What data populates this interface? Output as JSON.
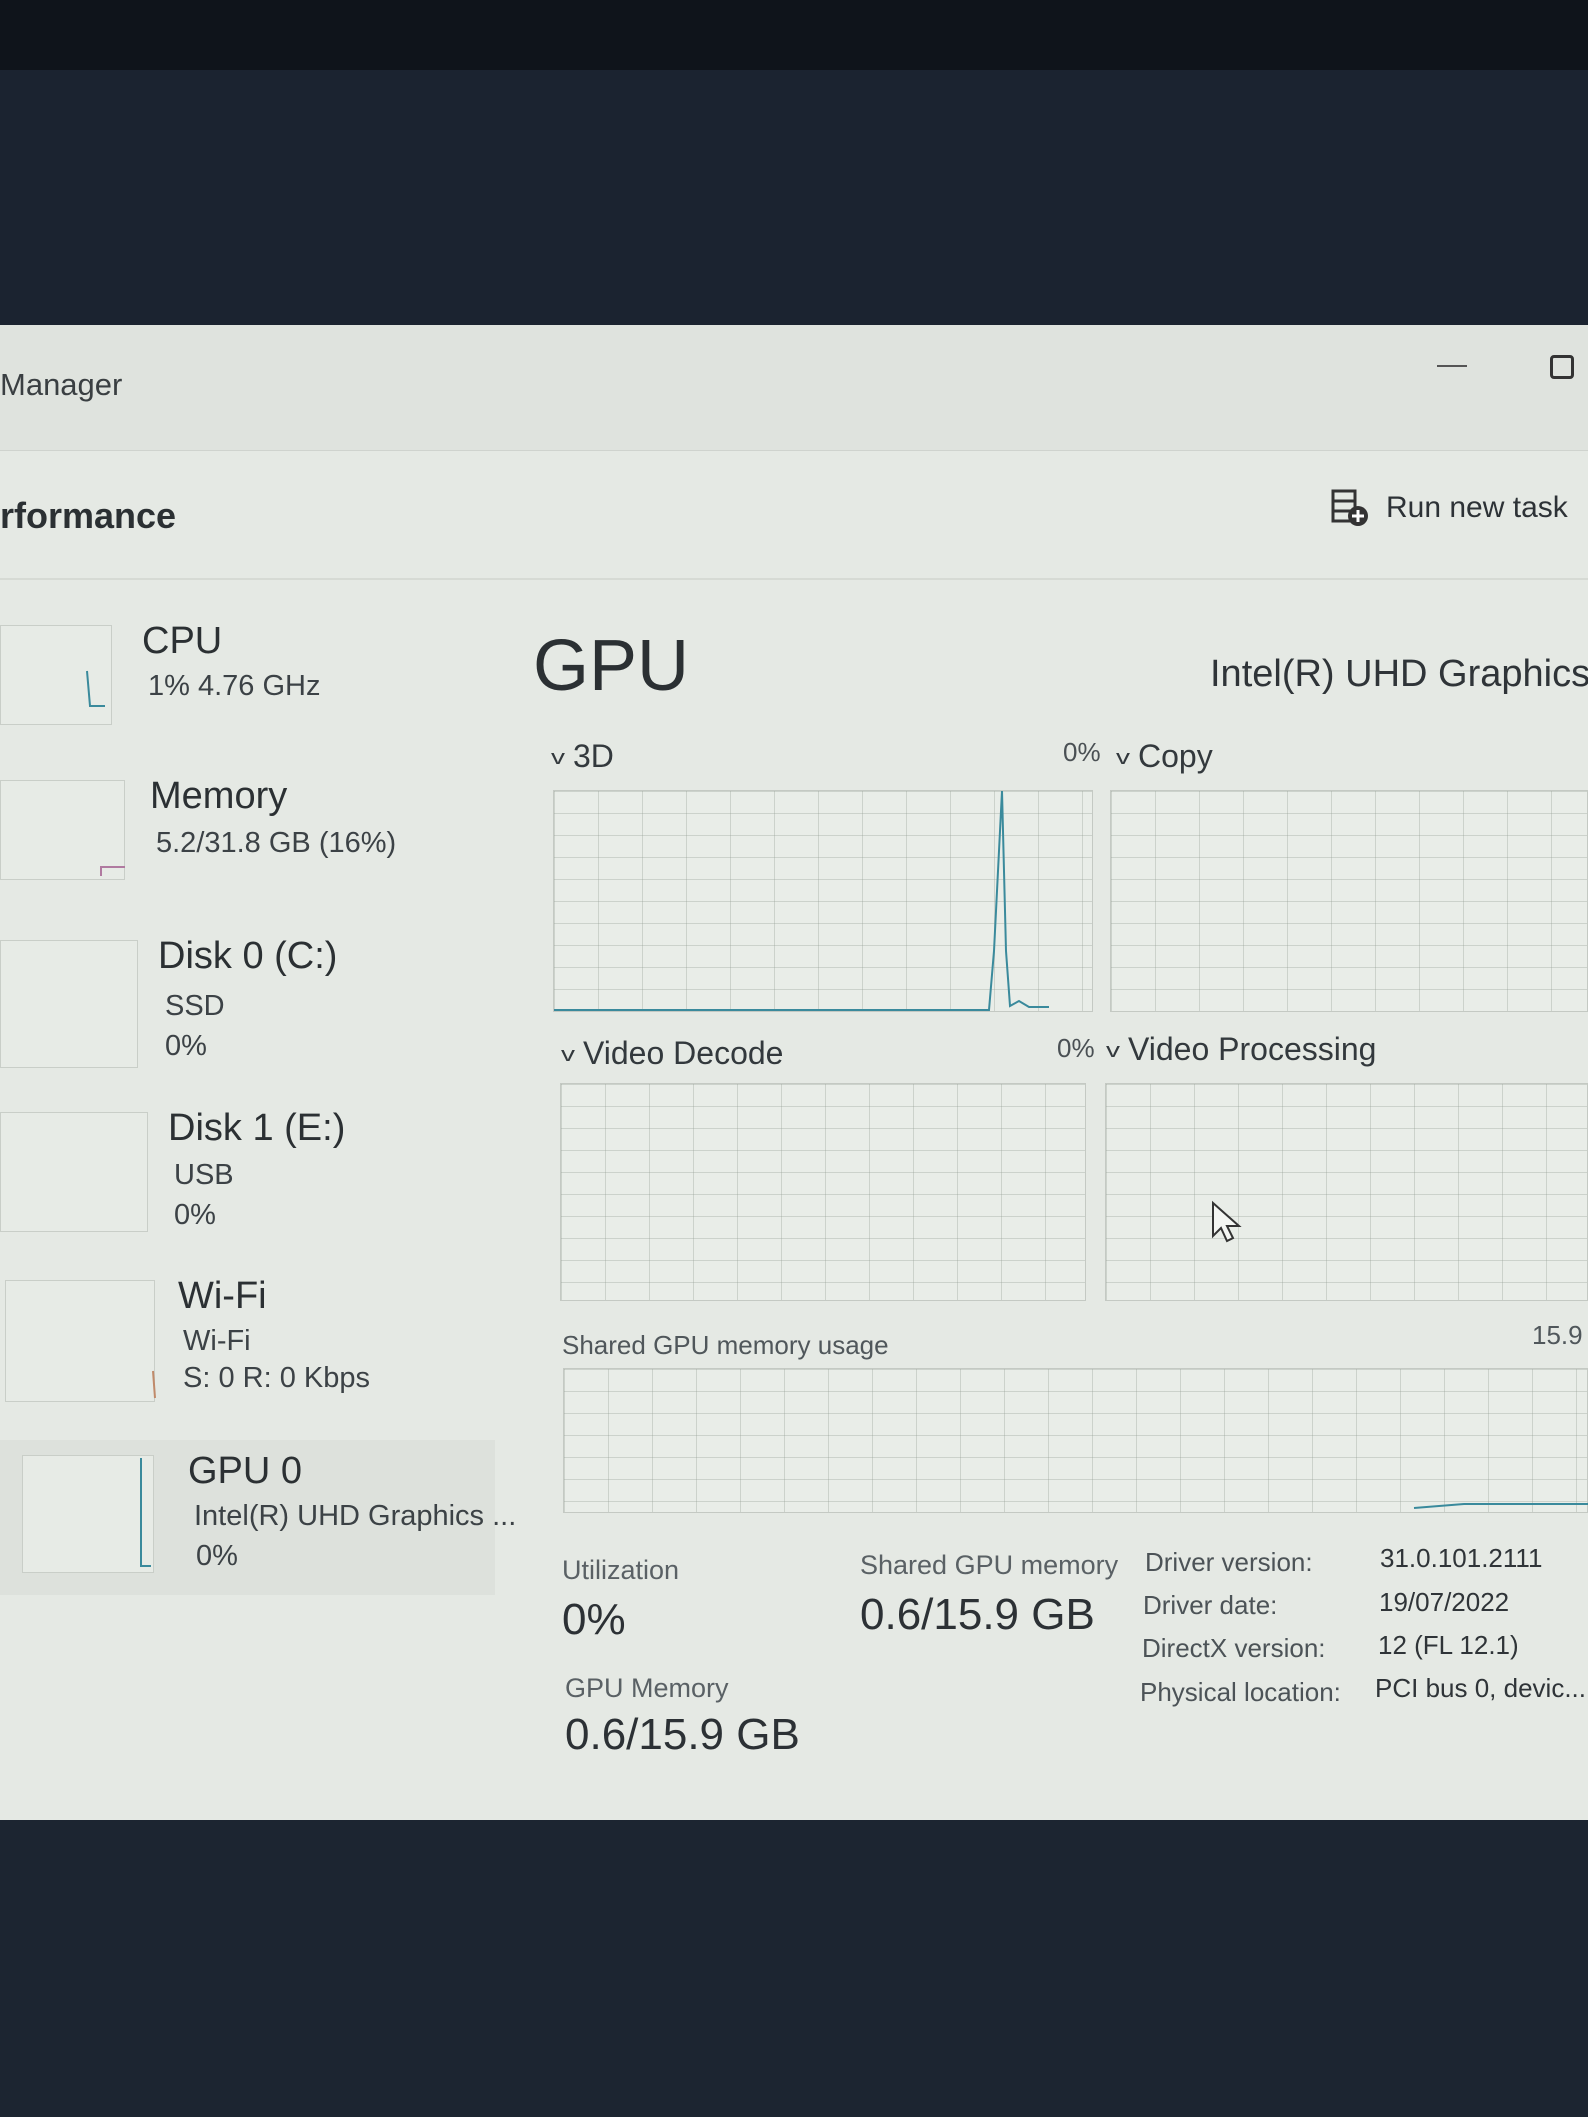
{
  "window": {
    "title": "Manager"
  },
  "header": {
    "title": "rformance",
    "run_new_task": "Run new task"
  },
  "sidebar": {
    "items": [
      {
        "name": "CPU",
        "line1": "1% 4.76 GHz",
        "line2": ""
      },
      {
        "name": "Memory",
        "line1": "5.2/31.8 GB (16%)",
        "line2": ""
      },
      {
        "name": "Disk 0 (C:)",
        "line1": "SSD",
        "line2": "0%"
      },
      {
        "name": "Disk 1 (E:)",
        "line1": "USB",
        "line2": "0%"
      },
      {
        "name": "Wi-Fi",
        "line1": "Wi-Fi",
        "line2": "S: 0 R: 0 Kbps"
      },
      {
        "name": "GPU 0",
        "line1": "Intel(R) UHD Graphics ...",
        "line2": "0%"
      }
    ]
  },
  "main": {
    "title": "GPU",
    "model": "Intel(R) UHD Graphics",
    "graphs": [
      {
        "label": "3D",
        "percent": "0%"
      },
      {
        "label": "Copy",
        "percent": ""
      },
      {
        "label": "Video Decode",
        "percent": "0%"
      },
      {
        "label": "Video Processing",
        "percent": ""
      }
    ],
    "shared_memory_graph": {
      "label": "Shared GPU memory usage",
      "max": "15.9"
    },
    "stats": {
      "utilization_label": "Utilization",
      "utilization_value": "0%",
      "shared_label": "Shared GPU memory",
      "shared_value": "0.6/15.9 GB",
      "gpu_memory_label": "GPU Memory",
      "gpu_memory_value": "0.6/15.9 GB"
    },
    "info": [
      {
        "key": "Driver version:",
        "value": "31.0.101.2111"
      },
      {
        "key": "Driver date:",
        "value": "19/07/2022"
      },
      {
        "key": "DirectX version:",
        "value": "12 (FL 12.1)"
      },
      {
        "key": "Physical location:",
        "value": "PCI bus 0, devic..."
      }
    ]
  },
  "colors": {
    "graph_line": "#3a8a9c",
    "memory_line": "#b07aa0",
    "wifi_line": "#c08a6a"
  }
}
